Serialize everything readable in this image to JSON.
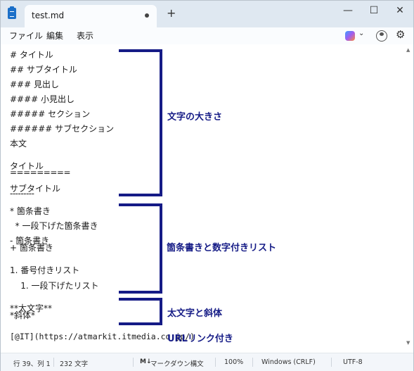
{
  "titlebar": {
    "tab_title": "test.md",
    "new_tab_label": "+",
    "minimize_label": "—",
    "maximize_label": "☐",
    "close_label": "✕"
  },
  "menu": {
    "file": "ファイル",
    "edit": "編集",
    "view": "表示"
  },
  "toolbar_icons": [
    "copilot-icon",
    "account-icon",
    "gear-icon"
  ],
  "editor": {
    "lines": [
      "# タイトル",
      "## サブタイトル",
      "### 見出し",
      "#### 小見出し",
      "##### セクション",
      "###### サブセクション",
      "本文",
      "タイトル",
      "=========",
      "サブタイトル",
      "---------",
      "* 箇条書き",
      "  * 一段下げた箇条書き",
      "- 箇条書き",
      "+ 箇条書き",
      "1. 番号付きリスト",
      "    1. 一段下げたリスト",
      "**太文字**",
      "*斜体*",
      "[@IT](https://atmarkit.itmedia.co.jp/)"
    ]
  },
  "annotations": {
    "headings": "文字の大きさ",
    "lists": "箇条書きと数字付きリスト",
    "emphasis": "太文字と斜体",
    "link": "URLリンク付き",
    "color": "#151b86"
  },
  "statusbar": {
    "position": "行 39、列 1",
    "char_count": "232 文字",
    "md_icon": "M↓",
    "syntax": "マークダウン構文",
    "zoom": "100%",
    "line_ending": "Windows (CRLF)",
    "encoding": "UTF-8"
  }
}
